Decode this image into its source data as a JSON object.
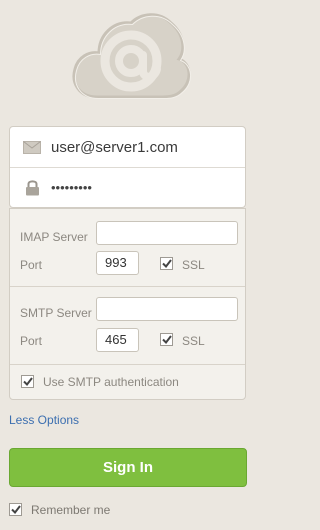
{
  "logo": {
    "icon": "cloud-at-icon"
  },
  "credentials": {
    "email": "user@server1.com",
    "password_mask": "•••••••••",
    "email_icon": "envelope-icon",
    "password_icon": "lock-icon"
  },
  "imap": {
    "server_label": "IMAP Server",
    "server_value": "",
    "port_label": "Port",
    "port_value": "993",
    "ssl_label": "SSL",
    "ssl_checked": true
  },
  "smtp": {
    "server_label": "SMTP Server",
    "server_value": "",
    "port_label": "Port",
    "port_value": "465",
    "ssl_label": "SSL",
    "ssl_checked": true
  },
  "auth": {
    "label": "Use SMTP authentication",
    "checked": true
  },
  "less_options": "Less Options",
  "sign_in": "Sign In",
  "remember": {
    "label": "Remember me",
    "checked": true
  },
  "colors": {
    "background": "#ebe7e0",
    "button_green": "#7fbf3f",
    "link_blue": "#3c6fb0"
  }
}
